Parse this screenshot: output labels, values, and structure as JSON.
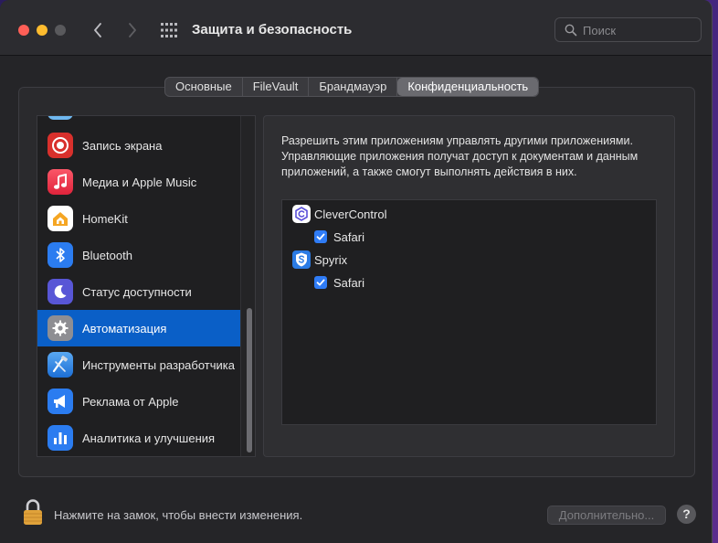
{
  "window": {
    "title": "Защита и безопасность"
  },
  "search": {
    "placeholder": "Поиск"
  },
  "tabs": [
    {
      "label": "Основные"
    },
    {
      "label": "FileVault"
    },
    {
      "label": "Брандмауэр"
    },
    {
      "label": "Конфиденциальность"
    }
  ],
  "active_tab": "Конфиденциальность",
  "sidebar": {
    "items": [
      {
        "label": "Запись экрана",
        "icon": "screen-recording-icon",
        "color": "#e0322f"
      },
      {
        "label": "Медиа и Apple Music",
        "icon": "music-note-icon",
        "color": "#f0394e"
      },
      {
        "label": "HomeKit",
        "icon": "home-icon",
        "color": "#ffffff"
      },
      {
        "label": "Bluetooth",
        "icon": "bluetooth-icon",
        "color": "#2b7cf0"
      },
      {
        "label": "Статус доступности",
        "icon": "moon-icon",
        "color": "#5856d6"
      },
      {
        "label": "Автоматизация",
        "icon": "gear-icon",
        "color": "#8e8e93"
      },
      {
        "label": "Инструменты разработчика",
        "icon": "developer-tools-icon",
        "color": "#3a8ee6"
      },
      {
        "label": "Реклама от Apple",
        "icon": "megaphone-icon",
        "color": "#2b7cf0"
      },
      {
        "label": "Аналитика и улучшения",
        "icon": "bar-chart-icon",
        "color": "#2b7cf0"
      }
    ],
    "selected": "Автоматизация"
  },
  "detail": {
    "description": "Разрешить этим приложениям управлять другими приложениями. Управляющие приложения получат доступ к документам и данным приложений, а также смогут выполнять действия в них.",
    "apps": [
      {
        "name": "CleverControl",
        "icon": "clevercontrol-icon",
        "targets": [
          {
            "name": "Safari",
            "checked": true
          }
        ]
      },
      {
        "name": "Spyrix",
        "icon": "spyrix-shield-icon",
        "targets": [
          {
            "name": "Safari",
            "checked": true
          }
        ]
      }
    ]
  },
  "footer": {
    "lock_text": "Нажмите на замок, чтобы внести изменения.",
    "advanced_label": "Дополнительно...",
    "help_label": "?"
  },
  "colors": {
    "accent": "#0a5fc7",
    "checkbox": "#2f7cf6"
  }
}
